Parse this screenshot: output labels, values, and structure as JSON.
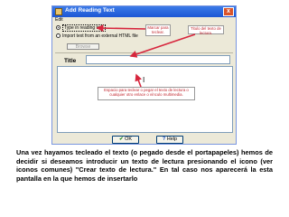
{
  "window": {
    "title": "Add Reading Text",
    "close_label": "x",
    "menu": "Edit"
  },
  "options": {
    "type_option": "Type in reading text",
    "import_option": "Import text from an external HTML file"
  },
  "buttons": {
    "browse": "Browse",
    "ok": "OK",
    "help": "Help",
    "ok_icon": "check-icon",
    "help_icon": "question-icon"
  },
  "form": {
    "title_label": "Title",
    "text_cursor": "I"
  },
  "annotations": {
    "choose": "Marcar para teclear.",
    "title_note": "Titulo del texto de lectura.",
    "area_note": "Espacio para teclear o pegar el texto de lectura o cualquier otro enlace o vínculo multimedia."
  },
  "caption": "Una vez hayamos tecleado el texto (o pegado desde el portapapeles) hemos de decidir si deseamos introducir un texto de lectura presionando el icono (ver iconos comunes) \"Crear texto de lectura.\" En tal caso nos aparecerá la esta pantalla en la que hemos de insertarlo",
  "colors": {
    "titlebar": "#1c56d4",
    "annotation_text": "#c2262e",
    "arrow": "#d7263d",
    "window_bg": "#ece9d8"
  }
}
